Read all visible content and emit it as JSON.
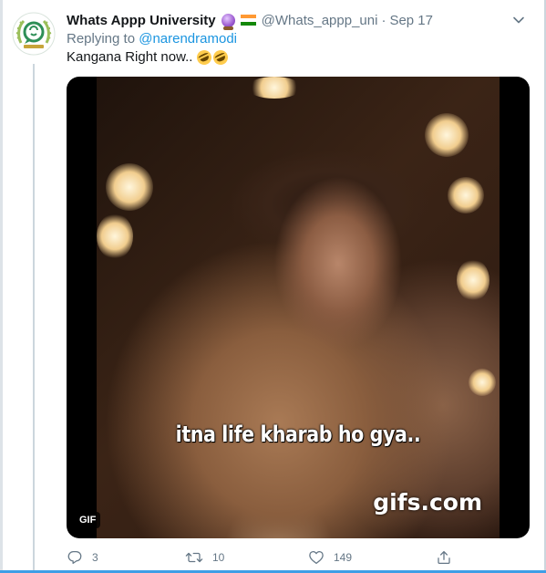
{
  "tweet": {
    "author_name": "Whats Appp University",
    "author_handle": "@Whats_appp_uni",
    "separator": "·",
    "date": "Sep 17",
    "reply_prefix": "Replying to",
    "reply_mention": "@narendramodi",
    "text": "Kangana Right now..",
    "text_emoji": [
      "rolling-on-floor-laughing",
      "rolling-on-floor-laughing"
    ],
    "header_emoji": [
      "crystal-ball",
      "india-flag"
    ]
  },
  "media": {
    "caption": "itna life kharab ho gya..",
    "watermark": "gifs.com",
    "badge": "GIF"
  },
  "actions": {
    "reply_count": "3",
    "retweet_count": "10",
    "like_count": "149"
  },
  "colors": {
    "link": "#1b95e0",
    "secondary_text": "#657786",
    "accent_bar": "#3e9ee6",
    "avatar_green": "#2e8f57"
  }
}
